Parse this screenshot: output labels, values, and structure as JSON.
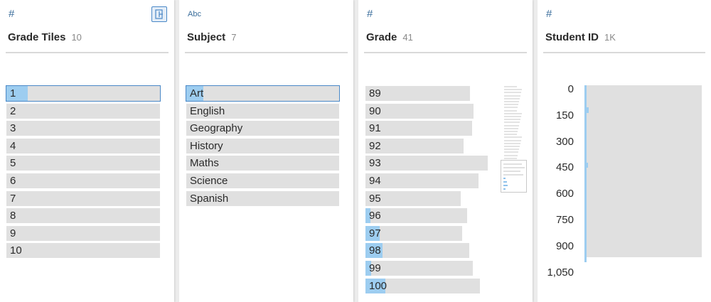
{
  "colors": {
    "accent": "#4a88c7",
    "fill": "#9dcdf0",
    "bar": "#e0e0e0"
  },
  "cards": [
    {
      "name": "grade-tiles",
      "type_icon": "#",
      "title": "Grade Tiles",
      "count": "10"
    },
    {
      "name": "subject",
      "type_icon": "Abc",
      "title": "Subject",
      "count": "7"
    },
    {
      "name": "grade",
      "type_icon": "#",
      "title": "Grade",
      "count": "41"
    },
    {
      "name": "student-id",
      "type_icon": "#",
      "title": "Student ID",
      "count": "1K"
    }
  ],
  "grade_tiles": {
    "items": [
      {
        "label": "1",
        "fill_pct": 14,
        "selected": true
      },
      {
        "label": "2",
        "fill_pct": 0
      },
      {
        "label": "3",
        "fill_pct": 0
      },
      {
        "label": "4",
        "fill_pct": 0
      },
      {
        "label": "5",
        "fill_pct": 0
      },
      {
        "label": "6",
        "fill_pct": 0
      },
      {
        "label": "7",
        "fill_pct": 0
      },
      {
        "label": "8",
        "fill_pct": 0
      },
      {
        "label": "9",
        "fill_pct": 0
      },
      {
        "label": "10",
        "fill_pct": 0
      }
    ]
  },
  "subject": {
    "items": [
      {
        "label": "Art",
        "fill_pct": 11,
        "selected": true
      },
      {
        "label": "English",
        "fill_pct": 0
      },
      {
        "label": "Geography",
        "fill_pct": 0
      },
      {
        "label": "History",
        "fill_pct": 0
      },
      {
        "label": "Maths",
        "fill_pct": 0
      },
      {
        "label": "Science",
        "fill_pct": 0
      },
      {
        "label": "Spanish",
        "fill_pct": 0
      }
    ]
  },
  "grade": {
    "items": [
      {
        "label": "89",
        "value": 147,
        "fill": 0
      },
      {
        "label": "90",
        "value": 152,
        "fill": 0
      },
      {
        "label": "91",
        "value": 150,
        "fill": 0
      },
      {
        "label": "92",
        "value": 138,
        "fill": 0
      },
      {
        "label": "93",
        "value": 172,
        "fill": 0
      },
      {
        "label": "94",
        "value": 159,
        "fill": 0
      },
      {
        "label": "95",
        "value": 134,
        "fill": 0
      },
      {
        "label": "96",
        "value": 143,
        "fill": 7
      },
      {
        "label": "97",
        "value": 136,
        "fill": 20
      },
      {
        "label": "98",
        "value": 146,
        "fill": 24
      },
      {
        "label": "99",
        "value": 151,
        "fill": 8
      },
      {
        "label": "100",
        "value": 161,
        "fill": 28
      }
    ]
  },
  "student_id": {
    "ticks": [
      "0",
      "150",
      "300",
      "450",
      "600",
      "750",
      "900",
      "1,050"
    ],
    "bins": [
      {
        "v": 165,
        "f": 3
      },
      {
        "v": 165,
        "f": 3
      },
      {
        "v": 165,
        "f": 3
      },
      {
        "v": 165,
        "f": 3
      },
      {
        "v": 165,
        "f": 6
      },
      {
        "v": 165,
        "f": 3
      },
      {
        "v": 165,
        "f": 3
      },
      {
        "v": 165,
        "f": 3
      },
      {
        "v": 165,
        "f": 3
      },
      {
        "v": 165,
        "f": 3
      },
      {
        "v": 165,
        "f": 3
      },
      {
        "v": 165,
        "f": 3
      },
      {
        "v": 165,
        "f": 3
      },
      {
        "v": 165,
        "f": 3
      },
      {
        "v": 165,
        "f": 5
      },
      {
        "v": 165,
        "f": 3
      },
      {
        "v": 165,
        "f": 3
      },
      {
        "v": 165,
        "f": 3
      },
      {
        "v": 165,
        "f": 3
      },
      {
        "v": 165,
        "f": 3
      },
      {
        "v": 165,
        "f": 3
      },
      {
        "v": 165,
        "f": 3
      },
      {
        "v": 165,
        "f": 3
      },
      {
        "v": 165,
        "f": 3
      },
      {
        "v": 165,
        "f": 3
      },
      {
        "v": 165,
        "f": 3
      },
      {
        "v": 165,
        "f": 3
      },
      {
        "v": 165,
        "f": 3
      },
      {
        "v": 165,
        "f": 3
      },
      {
        "v": 165,
        "f": 3
      },
      {
        "v": 165,
        "f": 3
      },
      {
        "v": 3,
        "f": 3
      }
    ]
  }
}
